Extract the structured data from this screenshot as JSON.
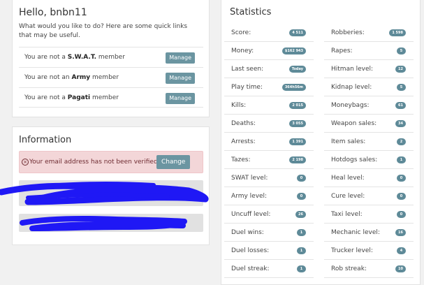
{
  "welcome": {
    "greeting": "Hello, bnbn11",
    "intro": "What would you like to do? Here are some quick links that may be useful.",
    "memberships": [
      {
        "prefix": "You are not a ",
        "org": "S.W.A.T.",
        "suffix": " member",
        "button": "Manage"
      },
      {
        "prefix": "You are not an ",
        "org": "Army",
        "suffix": " member",
        "button": "Manage"
      },
      {
        "prefix": "You are not a ",
        "org": "Pagati",
        "suffix": " member",
        "button": "Manage"
      }
    ]
  },
  "information": {
    "title": "Information",
    "alert_message": "Your email address has not been verified.",
    "alert_icon": "warning-circle-icon",
    "change_button": "Change",
    "redaction_color": "#1f18f5"
  },
  "statistics": {
    "title": "Statistics",
    "left": [
      {
        "label": "Score:",
        "value": "4 511"
      },
      {
        "label": "Money:",
        "value": "$162 943"
      },
      {
        "label": "Last seen:",
        "value": "Today"
      },
      {
        "label": "Play time:",
        "value": "364h56m"
      },
      {
        "label": "Kills:",
        "value": "2 015"
      },
      {
        "label": "Deaths:",
        "value": "3 055"
      },
      {
        "label": "Arrests:",
        "value": "1 391"
      },
      {
        "label": "Tazes:",
        "value": "2 198"
      },
      {
        "label": "SWAT level:",
        "value": "0"
      },
      {
        "label": "Army level:",
        "value": "0"
      },
      {
        "label": "Uncuff level:",
        "value": "26"
      },
      {
        "label": "Duel wins:",
        "value": "1"
      },
      {
        "label": "Duel losses:",
        "value": "1"
      },
      {
        "label": "Duel streak:",
        "value": "1"
      }
    ],
    "right": [
      {
        "label": "Robberies:",
        "value": "1 598"
      },
      {
        "label": "Rapes:",
        "value": "5"
      },
      {
        "label": "Hitman level:",
        "value": "12"
      },
      {
        "label": "Kidnap level:",
        "value": "5"
      },
      {
        "label": "Moneybags:",
        "value": "61"
      },
      {
        "label": "Weapon sales:",
        "value": "34"
      },
      {
        "label": "Item sales:",
        "value": "2"
      },
      {
        "label": "Hotdogs sales:",
        "value": "1"
      },
      {
        "label": "Heal level:",
        "value": "0"
      },
      {
        "label": "Cure level:",
        "value": "0"
      },
      {
        "label": "Taxi level:",
        "value": "0"
      },
      {
        "label": "Mechanic level:",
        "value": "16"
      },
      {
        "label": "Trucker level:",
        "value": "4"
      },
      {
        "label": "Rob streak:",
        "value": "10"
      }
    ]
  },
  "colors": {
    "button": "#6b95a1",
    "badge": "#5e8a98",
    "alert_bg": "#f3d6d8",
    "page_bg": "#f1f1f1"
  }
}
